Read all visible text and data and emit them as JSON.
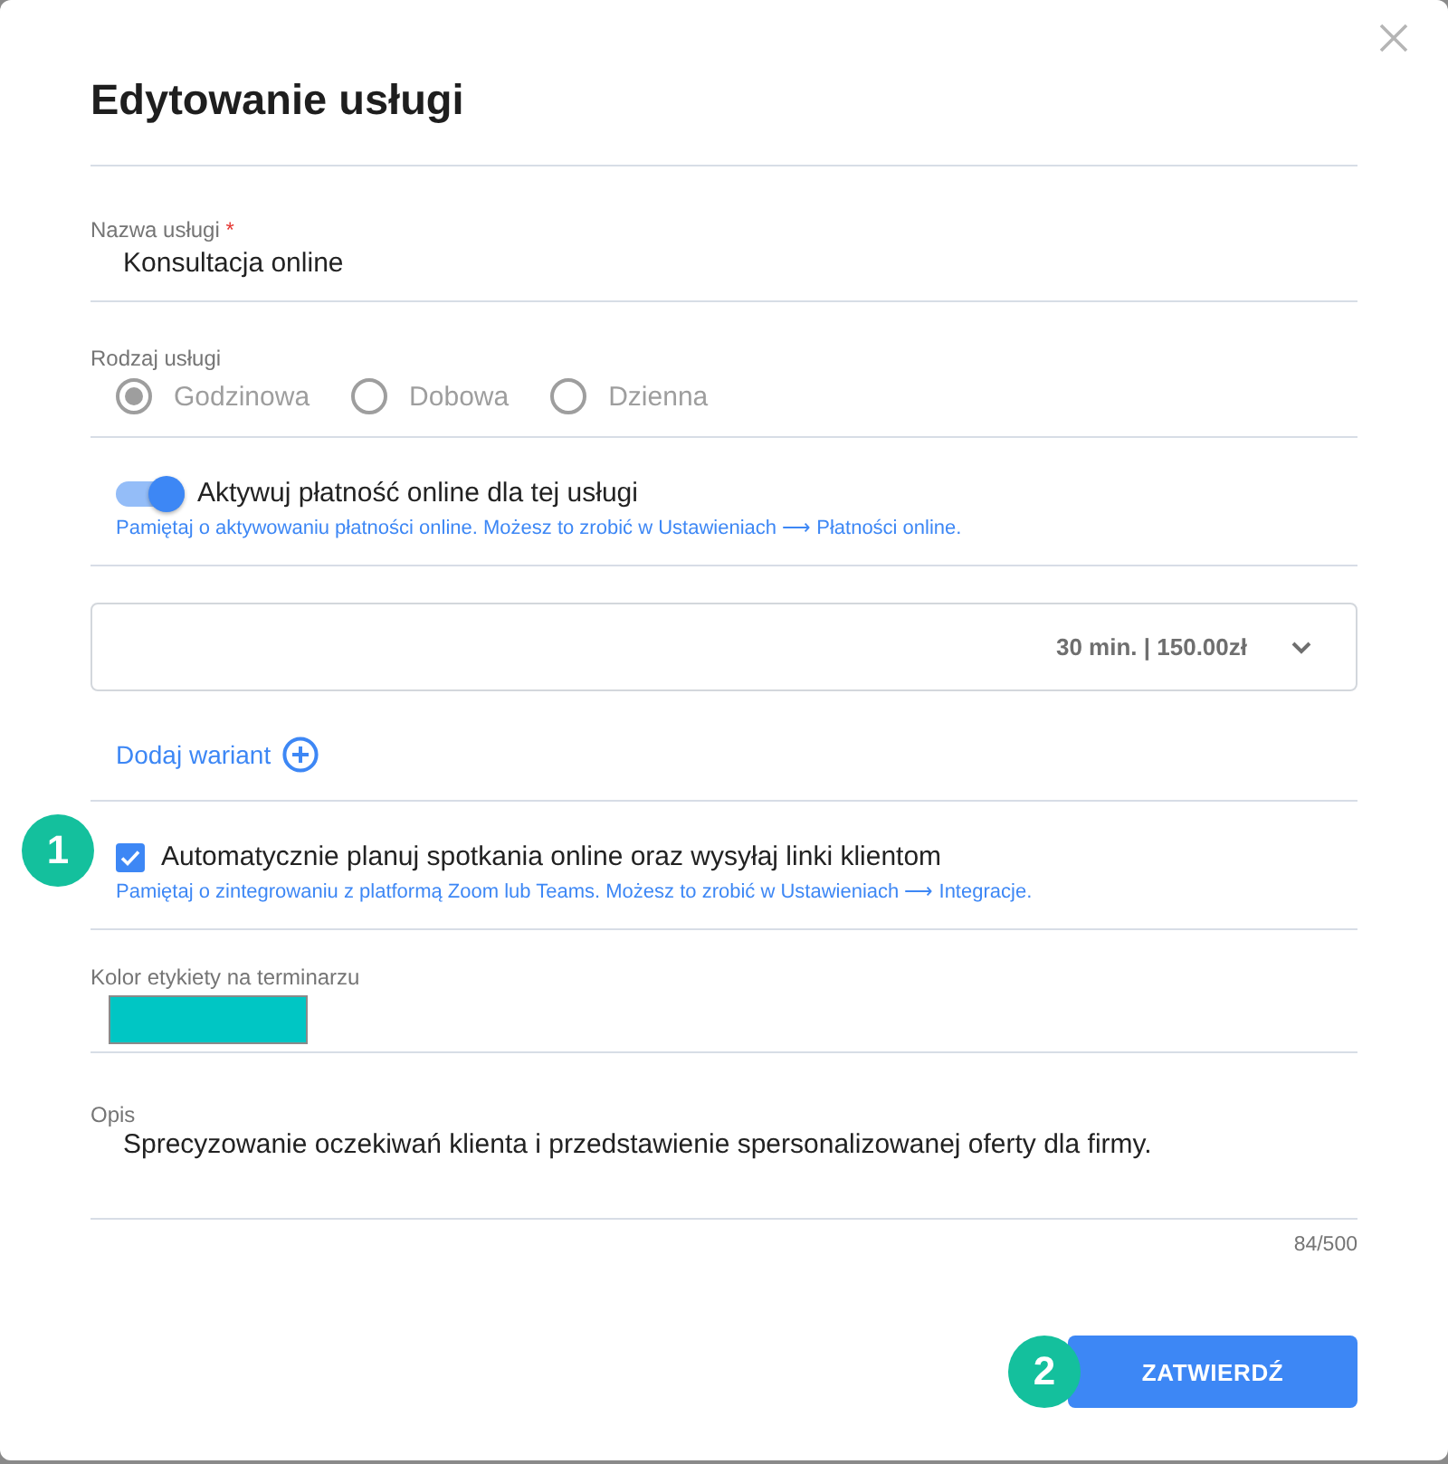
{
  "dialog": {
    "title": "Edytowanie usługi"
  },
  "name_field": {
    "label": "Nazwa usługi",
    "required_mark": "*",
    "value": "Konsultacja online"
  },
  "service_type": {
    "label": "Rodzaj usługi",
    "disabled": true,
    "options": [
      {
        "label": "Godzinowa",
        "selected": true
      },
      {
        "label": "Dobowa",
        "selected": false
      },
      {
        "label": "Dzienna",
        "selected": false
      }
    ]
  },
  "online_payment": {
    "label": "Aktywuj płatność online dla tej usługi",
    "on": true,
    "hint": "Pamiętaj o aktywowaniu płatności online. Możesz to zrobić w Ustawieniach ⟶ Płatności online."
  },
  "variants": [
    {
      "summary": "30 min. | 150.00zł",
      "expanded": false
    }
  ],
  "add_variant": {
    "label": "Dodaj wariant"
  },
  "auto_schedule": {
    "label": "Automatycznie planuj spotkania online oraz wysyłaj linki klientom",
    "checked": true,
    "hint": "Pamiętaj o zintegrowaniu z platformą Zoom lub Teams. Możesz to zrobić w Ustawieniach ⟶ Integracje."
  },
  "label_color": {
    "label": "Kolor etykiety na terminarzu",
    "color": "#00c6c4"
  },
  "description": {
    "label": "Opis",
    "value": "Sprecyzowanie oczekiwań klienta i przedstawienie spersonalizowanej oferty dla firmy.",
    "counter": "84/500"
  },
  "submit": {
    "label": "ZATWIERDŹ"
  },
  "annotations": [
    {
      "text": "1"
    },
    {
      "text": "2"
    }
  ]
}
